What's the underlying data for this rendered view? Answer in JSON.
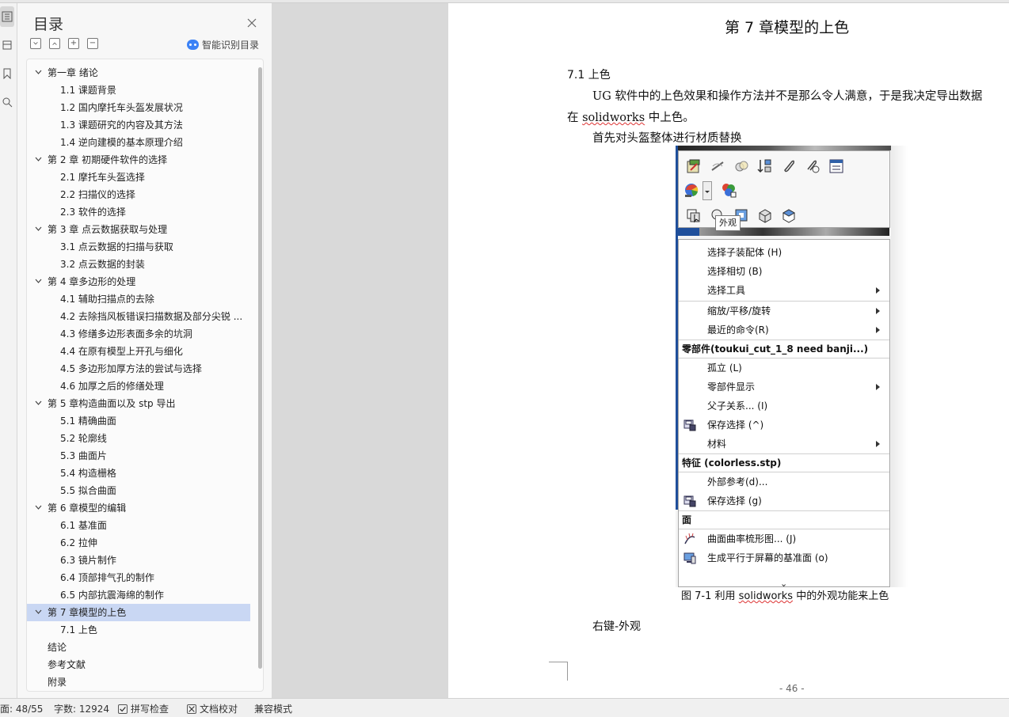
{
  "toc": {
    "title": "目录",
    "smart_toc_label": "智能识别目录",
    "tools": [
      "collapse",
      "expand",
      "add",
      "remove"
    ],
    "items": [
      {
        "label": "第一章  绪论",
        "level": 1,
        "collapsible": true
      },
      {
        "label": "1.1 课题背景",
        "level": 2
      },
      {
        "label": "1.2 国内摩托车头盔发展状况",
        "level": 2
      },
      {
        "label": "1.3 课题研究的内容及其方法",
        "level": 2
      },
      {
        "label": "1.4 逆向建模的基本原理介绍",
        "level": 2
      },
      {
        "label": "第 2 章  初期硬件软件的选择",
        "level": 1,
        "collapsible": true
      },
      {
        "label": "2.1 摩托车头盔选择",
        "level": 2
      },
      {
        "label": "2.2 扫描仪的选择",
        "level": 2
      },
      {
        "label": "2.3  软件的选择",
        "level": 2
      },
      {
        "label": "第 3 章    点云数据获取与处理",
        "level": 1,
        "collapsible": true
      },
      {
        "label": "3.1  点云数据的扫描与获取",
        "level": 2
      },
      {
        "label": "3.2  点云数据的封装",
        "level": 2
      },
      {
        "label": "第 4 章多边形的处理",
        "level": 1,
        "collapsible": true
      },
      {
        "label": "4.1  辅助扫描点的去除",
        "level": 2
      },
      {
        "label": "4.2  去除挡风板错误扫描数据及部分尖锐 ...",
        "level": 2
      },
      {
        "label": "4.3  修缮多边形表面多余的坑洞",
        "level": 2
      },
      {
        "label": "4.4  在原有模型上开孔与细化",
        "level": 2
      },
      {
        "label": "4.5  多边形加厚方法的尝试与选择",
        "level": 2
      },
      {
        "label": "4.6  加厚之后的修缮处理",
        "level": 2
      },
      {
        "label": "第 5 章构造曲面以及 stp 导出",
        "level": 1,
        "collapsible": true
      },
      {
        "label": "5.1  精确曲面",
        "level": 2
      },
      {
        "label": "5.2  轮廓线",
        "level": 2
      },
      {
        "label": "5.3  曲面片",
        "level": 2
      },
      {
        "label": "5.4  构造栅格",
        "level": 2
      },
      {
        "label": "5.5  拟合曲面",
        "level": 2
      },
      {
        "label": "第 6 章模型的编辑",
        "level": 1,
        "collapsible": true
      },
      {
        "label": "6.1  基准面",
        "level": 2
      },
      {
        "label": "6.2  拉伸",
        "level": 2
      },
      {
        "label": "6.3  镜片制作",
        "level": 2
      },
      {
        "label": "6.4  顶部排气孔的制作",
        "level": 2
      },
      {
        "label": "6.5  内部抗震海绵的制作",
        "level": 2
      },
      {
        "label": "第 7 章模型的上色",
        "level": 1,
        "collapsible": true,
        "active": true
      },
      {
        "label": "7.1  上色",
        "level": 2
      },
      {
        "label": "结论",
        "level": 1
      },
      {
        "label": "参考文献",
        "level": 1
      },
      {
        "label": "附录",
        "level": 1
      }
    ]
  },
  "document": {
    "chapter_title": "第 7 章模型的上色",
    "section_title": "7.1  上色",
    "para1_line1": "UG 软件中的上色效果和操作方法并不是那么令人满意，于是我决定导出数据",
    "para1_line2_pre": "在 ",
    "para1_line2_word": "solidworks",
    "para1_line2_post": " 中上色。",
    "para2": "首先对头盔整体进行材质替换",
    "caption_pre": "图 7-1  利用 ",
    "caption_word": "solidworks",
    "caption_post": " 中的外观功能来上色",
    "para3": "右键-外观",
    "page_number": "- 46 -"
  },
  "figure": {
    "tooltip": "外观",
    "menu": [
      {
        "type": "item",
        "label": "选择子装配体 (H)"
      },
      {
        "type": "item",
        "label": "选择相切 (B)"
      },
      {
        "type": "item",
        "label": "选择工具",
        "submenu": true
      },
      {
        "type": "sep"
      },
      {
        "type": "item",
        "label": "缩放/平移/旋转",
        "submenu": true
      },
      {
        "type": "item",
        "label": "最近的命令(R)",
        "submenu": true
      },
      {
        "type": "header",
        "label": "零部件(toukui_cut_1_8 need banji...)"
      },
      {
        "type": "item",
        "label": "孤立 (L)"
      },
      {
        "type": "item",
        "label": "零部件显示",
        "submenu": true
      },
      {
        "type": "item",
        "label": "父子关系... (I)"
      },
      {
        "type": "item",
        "label": "保存选择 (^)",
        "icon": "save-selection-icon"
      },
      {
        "type": "item",
        "label": "材料",
        "submenu": true
      },
      {
        "type": "header",
        "label": "特征 (colorless.stp)"
      },
      {
        "type": "item",
        "label": "外部参考(d)..."
      },
      {
        "type": "item",
        "label": "保存选择 (g)",
        "icon": "save-selection-icon"
      },
      {
        "type": "header",
        "label": "面"
      },
      {
        "type": "item",
        "label": "曲面曲率梳形图... (J)",
        "icon": "curvature-comb-icon"
      },
      {
        "type": "item",
        "label": "生成平行于屏幕的基准面 (o)",
        "icon": "parallel-plane-icon"
      }
    ]
  },
  "statusbar": {
    "page": "面: 48/55",
    "word_count": "字数: 12924",
    "spell_check": "拼写检查",
    "doc_proof": "文档校对",
    "compat_mode": "兼容模式"
  }
}
